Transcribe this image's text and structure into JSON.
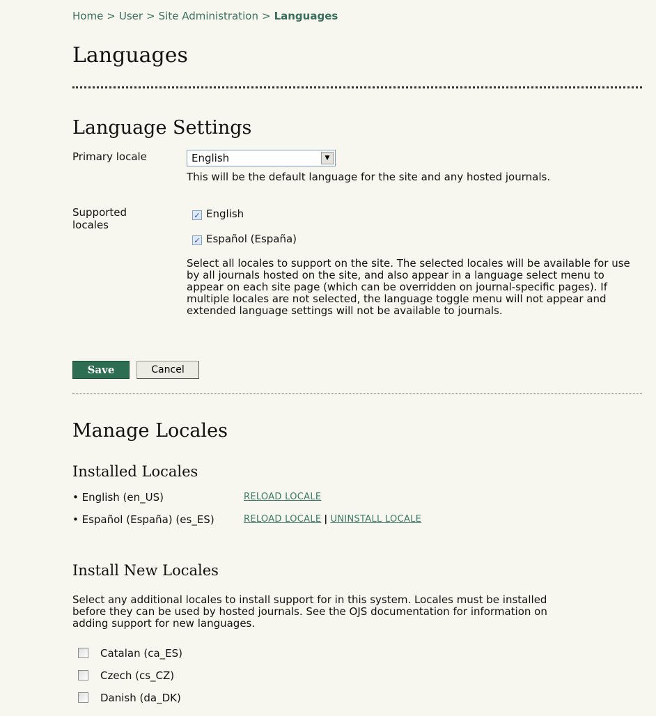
{
  "breadcrumb": {
    "items": [
      "Home",
      "User",
      "Site Administration"
    ],
    "separator": ">",
    "current": "Languages"
  },
  "page_title": "Languages",
  "language_settings": {
    "heading": "Language Settings",
    "primary_locale_label": "Primary locale",
    "primary_locale_value": "English",
    "primary_locale_help": "This will be the default language for the site and any hosted journals.",
    "supported_locales_label": "Supported locales",
    "supported_locales": [
      {
        "label": "English",
        "checked": true
      },
      {
        "label": "Español (España)",
        "checked": true
      }
    ],
    "supported_help": "Select all locales to support on the site. The selected locales will be available for use by all journals hosted on the site, and also appear in a language select menu to appear on each site page (which can be overridden on journal-specific pages). If multiple locales are not selected, the language toggle menu will not appear and extended language settings will not be available to journals.",
    "save_label": "Save",
    "cancel_label": "Cancel"
  },
  "manage_locales": {
    "heading": "Manage Locales",
    "installed_heading": "Installed Locales",
    "installed": [
      {
        "name": "• English (en_US)",
        "reload": "RELOAD LOCALE"
      },
      {
        "name": "• Español (España) (es_ES)",
        "reload": "RELOAD LOCALE",
        "uninstall": "UNINSTALL LOCALE"
      }
    ],
    "link_separator": "|",
    "install_heading": "Install New Locales",
    "install_help": "Select any additional locales to install support for in this system. Locales must be installed before they can be used by hosted journals. See the OJS documentation for information on adding support for new languages.",
    "new_locales": [
      {
        "label": "Catalan (ca_ES)",
        "checked": false
      },
      {
        "label": "Czech (cs_CZ)",
        "checked": false
      },
      {
        "label": "Danish (da_DK)",
        "checked": false
      }
    ]
  },
  "colors": {
    "background": "#f7f7ef",
    "link": "#3a7a66",
    "save_button": "#2d6e53"
  }
}
